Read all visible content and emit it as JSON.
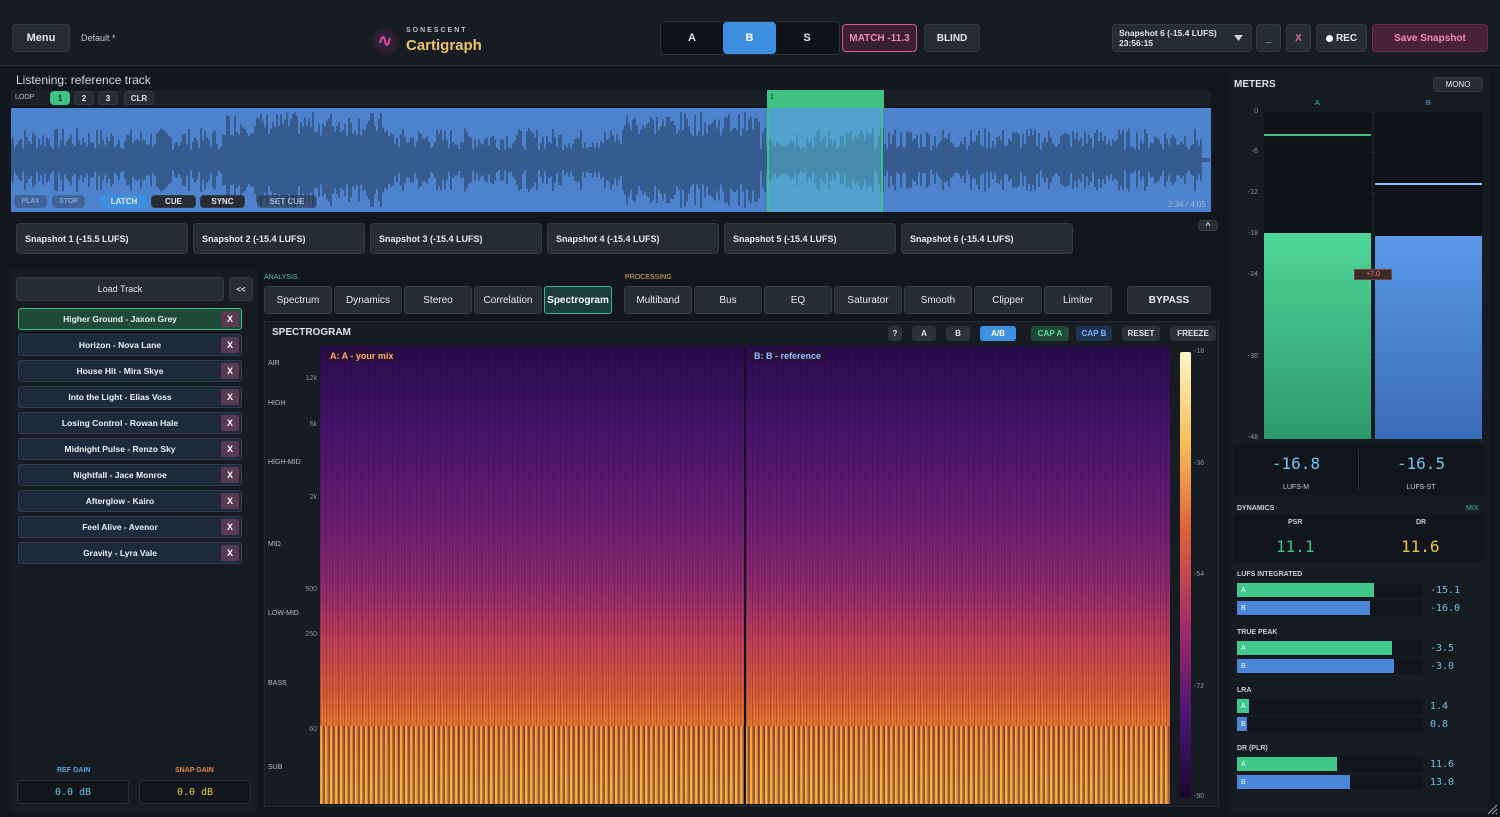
{
  "header": {
    "menu_label": "Menu",
    "preset": "Default *",
    "brand_small": "SONESCENT",
    "brand_name": "Cartigraph",
    "ab": [
      "A",
      "B",
      "S"
    ],
    "match_label": "MATCH -11.3",
    "blind_label": "BLIND",
    "snapshot_select": "Snapshot 6 (-15.4 LUFS) 23:56:15",
    "minimize_label": "_",
    "close_label": "X",
    "rec_label": "REC",
    "save_label": "Save Snapshot"
  },
  "transport": {
    "listening": "Listening: reference track",
    "loop_label": "LOOP",
    "loop_slots": [
      "1",
      "2",
      "3"
    ],
    "clear_label": "CLR",
    "marker_label": "1",
    "buttons": [
      "PLAY",
      "STOP",
      "LATCH",
      "CUE",
      "SYNC",
      "SET CUE"
    ],
    "time": "2:34 / 4:05",
    "playhead_fraction": 0.63
  },
  "snapshots": [
    "Snapshot 1 (-15.5 LUFS)",
    "Snapshot 2 (-15.4 LUFS)",
    "Snapshot 3 (-15.4 LUFS)",
    "Snapshot 4 (-15.4 LUFS)",
    "Snapshot 5 (-15.4 LUFS)",
    "Snapshot 6 (-15.4 LUFS)"
  ],
  "snapshots_toggle": "^",
  "tracks": {
    "load_label": "Load Track",
    "collapse_label": "<<",
    "remove_label": "X",
    "items": [
      "Higher Ground - Jaxon Grey",
      "Horizon - Nova Lane",
      "House Hit - Mira Skye",
      "Into the Light - Elias Voss",
      "Losing Control - Rowan Hale",
      "Midnight Pulse - Renzo Sky",
      "Nightfall - Jace Monroe",
      "Afterglow - Kairo",
      "Feel Alive - Avenor",
      "Gravity - Lyra Vale"
    ]
  },
  "gains": {
    "ref_label": "REF GAIN",
    "ref_value": "0.0 dB",
    "snap_label": "SNAP GAIN",
    "snap_value": "0.0 dB"
  },
  "tabs": {
    "analysis_label": "ANALYSIS",
    "processing_label": "PROCESSING",
    "analysis": [
      "Spectrum",
      "Dynamics",
      "Stereo",
      "Correlation",
      "Spectrogram"
    ],
    "processing": [
      "Multiband",
      "Bus",
      "EQ",
      "Saturator",
      "Smooth",
      "Clipper",
      "Limiter"
    ],
    "bypass_label": "BYPASS"
  },
  "spectrogram": {
    "title": "SPECTROGRAM",
    "buttons": [
      "?",
      "A",
      "B",
      "A/B",
      "CAP A",
      "CAP B",
      "RESET",
      "FREEZE"
    ],
    "label_a": "A: A - your mix",
    "label_b": "B: B - reference",
    "bands": [
      "AIR",
      "HIGH",
      "HIGH-MID",
      "MID",
      "LOW-MID",
      "BASS",
      "SUB"
    ],
    "freqs": [
      "12k",
      "6k",
      "2k",
      "500",
      "250",
      "60"
    ],
    "scale": [
      "-18",
      "-36",
      "-54",
      "-72",
      "-90"
    ]
  },
  "meters": {
    "title": "METERS",
    "mono_label": "MONO",
    "ch_a": "A",
    "ch_b": "B",
    "scale": [
      "0",
      "-6",
      "-12",
      "-18",
      "-24",
      "-36",
      "-48"
    ],
    "level_a": 0.63,
    "level_b": 0.62,
    "diff_label": "+7.0",
    "lufs_m": "-16.8",
    "lufs_m_label": "LUFS-M",
    "lufs_st": "-16.5",
    "lufs_st_label": "LUFS-ST",
    "dynamics_label": "DYNAMICS",
    "mix_label": "MIX",
    "psr_label": "PSR",
    "psr": "11.1",
    "dr_label": "DR",
    "dr": "11.6",
    "groups": [
      {
        "label": "LUFS INTEGRATED",
        "a": "-15.1",
        "b": "-16.0",
        "fa": 0.74,
        "fb": 0.72
      },
      {
        "label": "TRUE PEAK",
        "a": "-3.5",
        "b": "-3.0",
        "fa": 0.84,
        "fb": 0.85
      },
      {
        "label": "LRA",
        "a": "1.4",
        "b": "0.8",
        "fa": 0.05,
        "fb": 0.03
      },
      {
        "label": "DR (PLR)",
        "a": "11.6",
        "b": "13.0",
        "fa": 0.54,
        "fb": 0.61
      }
    ]
  },
  "colors": {
    "green": "#41c98c",
    "blue": "#4a87d8",
    "pink": "#e06a9a",
    "cyan": "#58b9de",
    "yellow": "#e3c84d"
  }
}
